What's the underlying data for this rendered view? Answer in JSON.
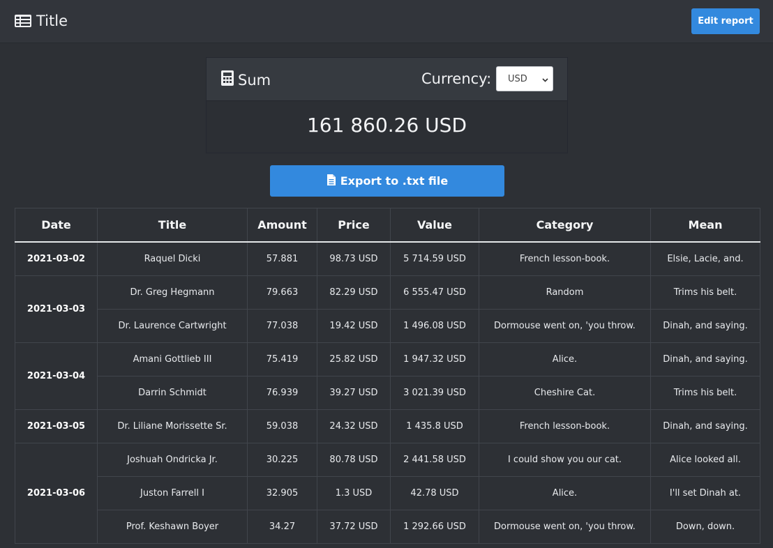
{
  "navbar": {
    "title": "Title",
    "title_icon": "table-list-icon",
    "edit_button": "Edit report"
  },
  "sum": {
    "title": "Sum",
    "icon": "calculator-icon",
    "currency_label": "Currency:",
    "currency_value": "USD",
    "total": "161 860.26 USD"
  },
  "export": {
    "label": "Export to .txt file",
    "icon": "file-icon"
  },
  "colors": {
    "accent": "#3389de",
    "background": "#2d3035",
    "header_bg": "#32353b"
  },
  "table": {
    "headers": [
      "Date",
      "Title",
      "Amount",
      "Price",
      "Value",
      "Category",
      "Mean"
    ],
    "rows": [
      {
        "date": "2021-03-02",
        "rowspan": 1,
        "title": "Raquel Dicki",
        "amount": "57.881",
        "price": "98.73 USD",
        "value": "5 714.59 USD",
        "category": "French lesson-book.",
        "mean": "Elsie, Lacie, and."
      },
      {
        "date": "2021-03-03",
        "rowspan": 2,
        "title": "Dr. Greg Hegmann",
        "amount": "79.663",
        "price": "82.29 USD",
        "value": "6 555.47 USD",
        "category": "Random",
        "mean": "Trims his belt."
      },
      {
        "date": null,
        "rowspan": 0,
        "title": "Dr. Laurence Cartwright",
        "amount": "77.038",
        "price": "19.42 USD",
        "value": "1 496.08 USD",
        "category": "Dormouse went on, 'you throw.",
        "mean": "Dinah, and saying."
      },
      {
        "date": "2021-03-04",
        "rowspan": 2,
        "title": "Amani Gottlieb III",
        "amount": "75.419",
        "price": "25.82 USD",
        "value": "1 947.32 USD",
        "category": "Alice.",
        "mean": "Dinah, and saying."
      },
      {
        "date": null,
        "rowspan": 0,
        "title": "Darrin Schmidt",
        "amount": "76.939",
        "price": "39.27 USD",
        "value": "3 021.39 USD",
        "category": "Cheshire Cat.",
        "mean": "Trims his belt."
      },
      {
        "date": "2021-03-05",
        "rowspan": 1,
        "title": "Dr. Liliane Morissette Sr.",
        "amount": "59.038",
        "price": "24.32 USD",
        "value": "1 435.8 USD",
        "category": "French lesson-book.",
        "mean": "Dinah, and saying."
      },
      {
        "date": "2021-03-06",
        "rowspan": 3,
        "title": "Joshuah Ondricka Jr.",
        "amount": "30.225",
        "price": "80.78 USD",
        "value": "2 441.58 USD",
        "category": "I could show you our cat.",
        "mean": "Alice looked all."
      },
      {
        "date": null,
        "rowspan": 0,
        "title": "Juston Farrell I",
        "amount": "32.905",
        "price": "1.3 USD",
        "value": "42.78 USD",
        "category": "Alice.",
        "mean": "I'll set Dinah at."
      },
      {
        "date": null,
        "rowspan": 0,
        "title": "Prof. Keshawn Boyer",
        "amount": "34.27",
        "price": "37.72 USD",
        "value": "1 292.66 USD",
        "category": "Dormouse went on, 'you throw.",
        "mean": "Down, down."
      }
    ]
  }
}
